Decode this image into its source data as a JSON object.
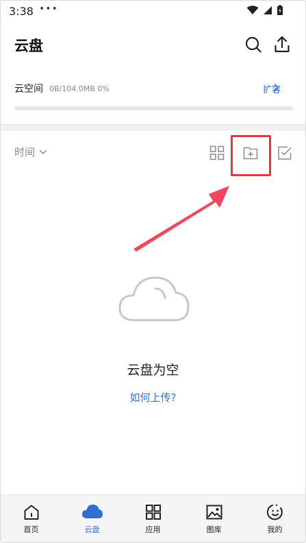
{
  "status_bar": {
    "time": "3:38",
    "dots": "•••"
  },
  "header": {
    "title": "云盘"
  },
  "storage": {
    "label": "云空间",
    "usage": "0B/104.0MB 0%",
    "used_fraction": 0,
    "expand_label": "扩容"
  },
  "toolbar": {
    "sort_label": "时间"
  },
  "empty_state": {
    "title": "云盘为空",
    "link": "如何上传?"
  },
  "bottom_nav": {
    "items": [
      {
        "label": "首页",
        "icon": "home-icon",
        "active": false
      },
      {
        "label": "云盘",
        "icon": "cloud-icon",
        "active": true
      },
      {
        "label": "应用",
        "icon": "apps-icon",
        "active": false
      },
      {
        "label": "图库",
        "icon": "gallery-icon",
        "active": false
      },
      {
        "label": "我的",
        "icon": "profile-icon",
        "active": false
      }
    ]
  },
  "colors": {
    "accent": "#2f6fcf",
    "annotation_red": "#e8333e",
    "arrow_pink": "#f2475f"
  }
}
